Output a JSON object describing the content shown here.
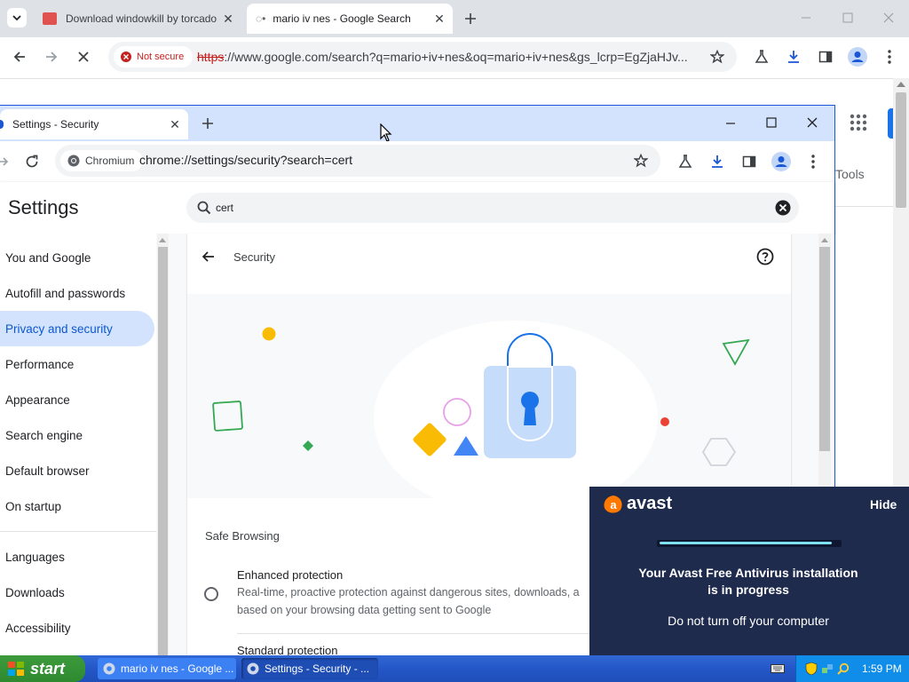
{
  "back_window": {
    "tabs": [
      {
        "title": "Download windowkill by torcado - itch.io",
        "close": "✕"
      },
      {
        "title": "mario iv nes - Google Search",
        "close": "✕"
      }
    ],
    "security_chip": "Not secure",
    "url_scheme": "https",
    "url_rest": "://www.google.com/search?q=mario+iv+nes&oq=mario+iv+nes&gs_lcrp=EgZjaHJv...",
    "tools_label": "Tools"
  },
  "settings_window": {
    "tab_title": "Settings - Security",
    "chip_label": "Chromium",
    "url": "chrome://settings/security?search=cert",
    "page_title": "Settings",
    "search_value": "cert",
    "nav": [
      {
        "label": "You and Google"
      },
      {
        "label": "Autofill and passwords"
      },
      {
        "label": "Privacy and security",
        "active": true
      },
      {
        "label": "Performance"
      },
      {
        "label": "Appearance"
      },
      {
        "label": "Search engine"
      },
      {
        "label": "Default browser"
      },
      {
        "label": "On startup"
      },
      {
        "label": "Languages"
      },
      {
        "label": "Downloads"
      },
      {
        "label": "Accessibility"
      }
    ],
    "section_title": "Security",
    "safe_browsing_heading": "Safe Browsing",
    "enhanced": {
      "title": "Enhanced protection",
      "desc_line1": "Real-time, proactive protection against dangerous sites, downloads, a",
      "desc_line2": "based on your browsing data getting sent to Google"
    },
    "standard": {
      "title": "Standard protection"
    }
  },
  "avast": {
    "brand": "avast",
    "hide": "Hide",
    "message_line1": "Your Avast Free Antivirus installation",
    "message_line2": "is in progress",
    "note": "Do not turn off your computer"
  },
  "taskbar": {
    "start": "start",
    "items": [
      {
        "label": "mario iv nes - Google ..."
      },
      {
        "label": "Settings - Security - ..."
      }
    ],
    "clock": "1:59 PM"
  },
  "colors": {
    "accent": "#0b57d0",
    "avast_bg": "#1e2b4c",
    "avast_orange": "#ff7800",
    "taskbar": "#2456c7"
  }
}
